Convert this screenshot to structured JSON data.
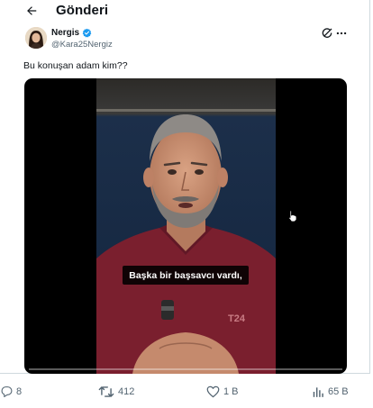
{
  "header": {
    "title": "Gönderi",
    "back_icon": "arrow-left-icon"
  },
  "post": {
    "author": {
      "display_name": "Nergis",
      "handle": "@Kara25Nergiz",
      "verified": true
    },
    "text": "Bu konuşan adam kim??",
    "video": {
      "caption": "Başka bir başsavcı vardı,",
      "progress": 0.0,
      "shirt_logo": "T24"
    }
  },
  "actions": {
    "replies": "8",
    "reposts": "412",
    "likes": "1 B",
    "views": "65 B"
  },
  "colors": {
    "accent": "#1d9bf0",
    "muted": "#536471",
    "text": "#0f1419",
    "shirt": "#7a1f2e"
  }
}
